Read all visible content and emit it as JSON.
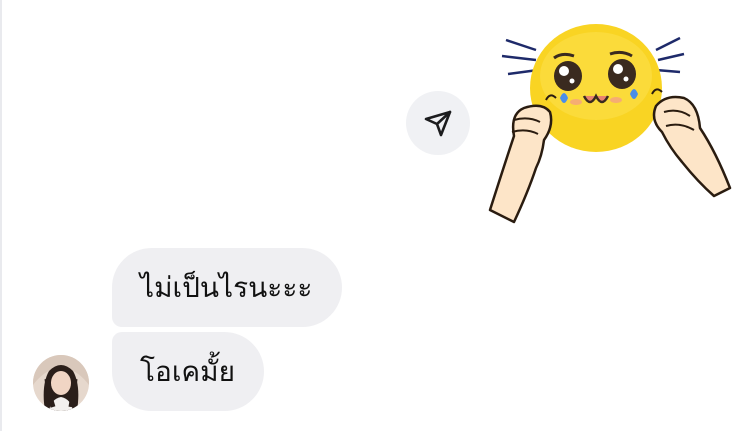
{
  "thread": {
    "messages": [
      {
        "sender": "other",
        "text": "ไม่เป็นไรนะะะ"
      },
      {
        "sender": "other",
        "text": "โอเคมั้ย"
      }
    ],
    "sent_sticker": {
      "icon": "hands-squeezing-yellow-emoji-sticker"
    },
    "share_icon": "send-arrow-icon"
  },
  "colors": {
    "incoming_bubble": "#efeff2",
    "share_button_bg": "#f0f1f4",
    "text": "#111111"
  }
}
